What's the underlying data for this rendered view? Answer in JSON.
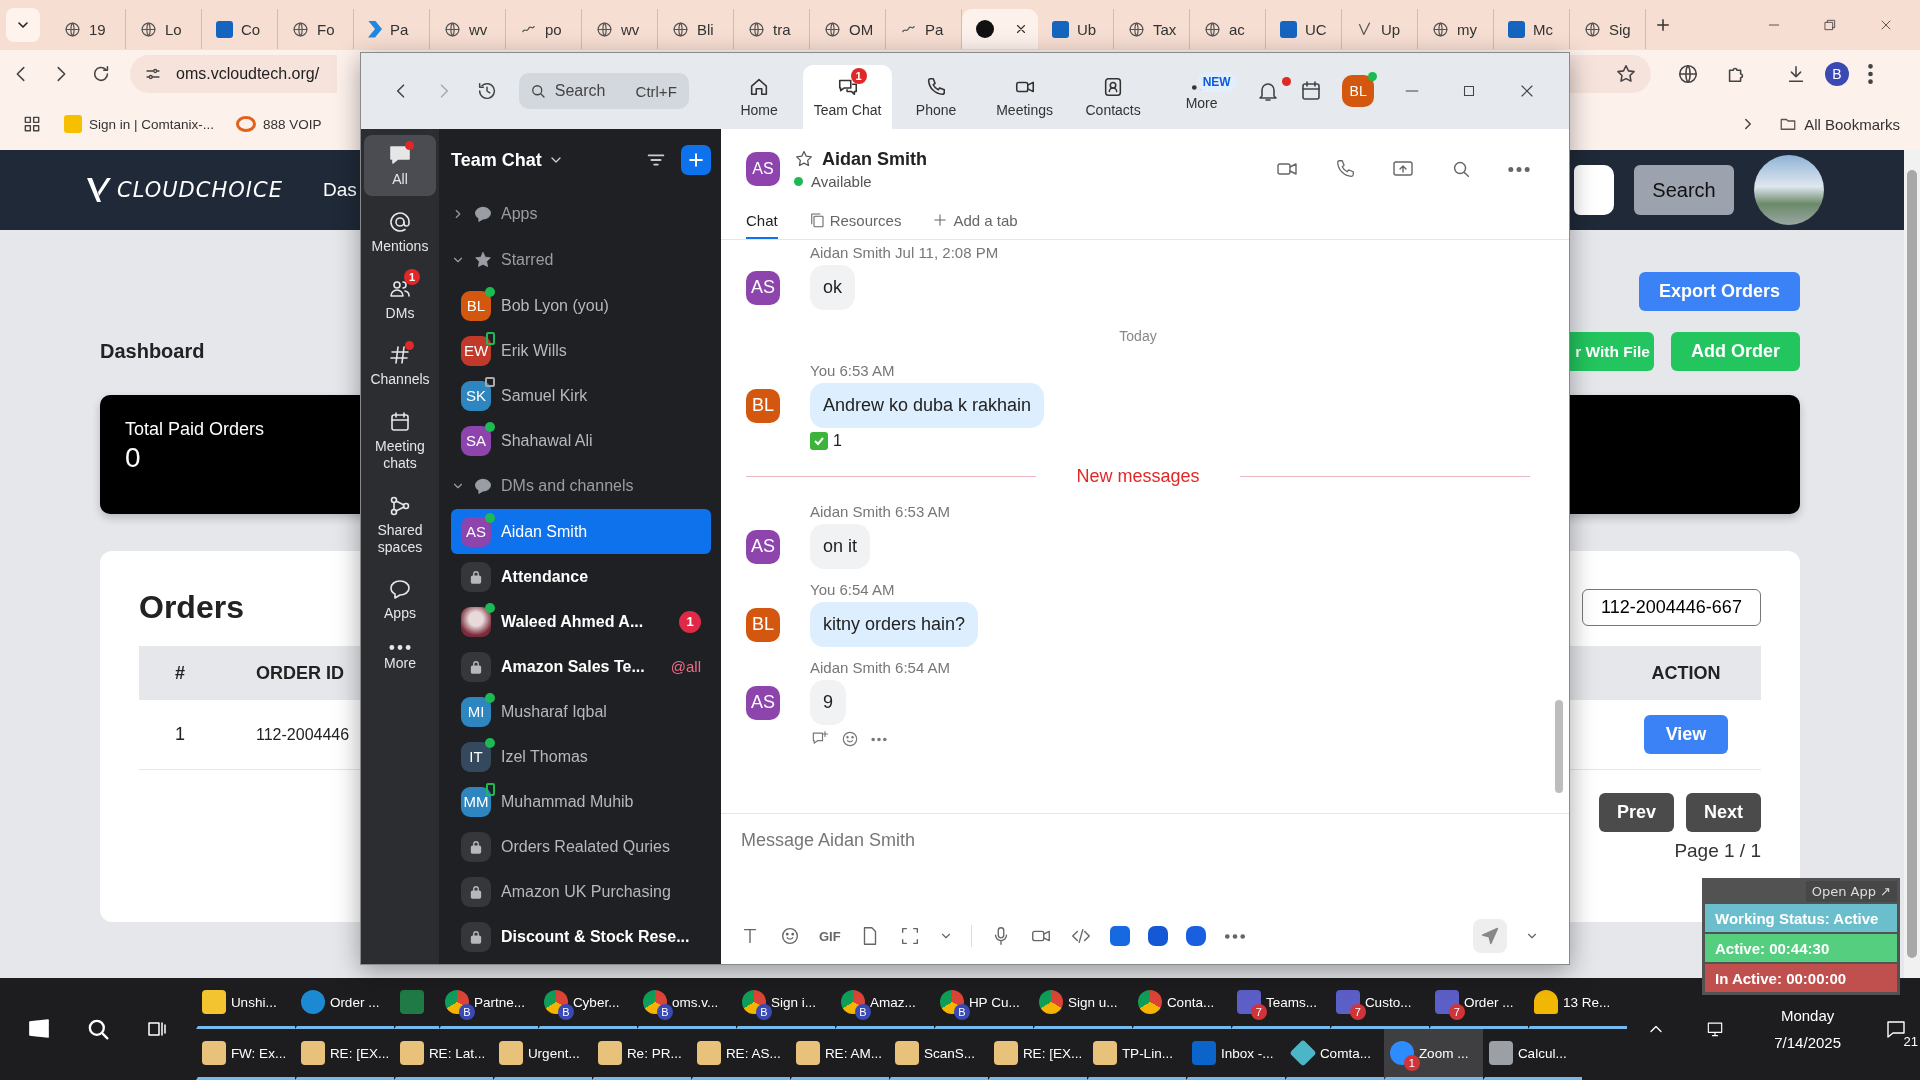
{
  "browser": {
    "tabs": [
      {
        "title": "19",
        "kind": "globe",
        "selected": false
      },
      {
        "title": "Lo",
        "kind": "globe",
        "selected": false
      },
      {
        "title": "Co",
        "kind": "box",
        "selected": false
      },
      {
        "title": "Fo",
        "kind": "globe",
        "selected": false
      },
      {
        "title": "Pa",
        "kind": "chevron",
        "selected": false
      },
      {
        "title": "wv",
        "kind": "globe",
        "selected": false
      },
      {
        "title": "po",
        "kind": "wave",
        "selected": false
      },
      {
        "title": "wv",
        "kind": "globe",
        "selected": false
      },
      {
        "title": "Bli",
        "kind": "globe",
        "selected": false
      },
      {
        "title": "tra",
        "kind": "globe",
        "selected": false
      },
      {
        "title": "OM",
        "kind": "globe",
        "selected": false
      },
      {
        "title": "Pa",
        "kind": "wave",
        "selected": false
      },
      {
        "kind": "dark",
        "selected": true
      },
      {
        "title": "Ub",
        "kind": "box",
        "selected": false
      },
      {
        "title": "Tax",
        "kind": "globe",
        "selected": false
      },
      {
        "title": "ac",
        "kind": "globe",
        "selected": false
      },
      {
        "title": "UC",
        "kind": "box",
        "selected": false
      },
      {
        "title": "Up",
        "kind": "check",
        "selected": false
      },
      {
        "title": "my",
        "kind": "globe",
        "selected": false
      },
      {
        "title": "Mc",
        "kind": "box",
        "selected": false
      },
      {
        "title": "Sig",
        "kind": "globe",
        "selected": false
      }
    ],
    "url": "oms.vcloudtech.org/",
    "profile": "B",
    "bookmarks": [
      {
        "label": "Sign in | Comtanix-...",
        "kind": "w"
      },
      {
        "label": "888 VOIP",
        "kind": "rings"
      }
    ],
    "all_bookmarks": "All Bookmarks"
  },
  "web_page": {
    "logo": "CLOUDCHOICE",
    "nav_item": "Das",
    "search_button": "Search",
    "heading": "Dashboard",
    "top_button": {
      "label": "Export Orders"
    },
    "buttons": [
      {
        "label": "r With File"
      },
      {
        "label": "Add Order"
      }
    ],
    "stat": {
      "label": "Total Paid Orders",
      "value": "0"
    },
    "orders": {
      "title": "Orders",
      "search_value": "112-2004446-667",
      "columns": [
        "#",
        "ORDER ID",
        "ACTION"
      ],
      "rows": [
        {
          "index": "1",
          "order_id": "112-2004446",
          "action": "View"
        }
      ],
      "prev": "Prev",
      "next": "Next",
      "page": "Page 1 / 1"
    }
  },
  "zoom": {
    "search": {
      "placeholder": "Search",
      "shortcut": "Ctrl+F"
    },
    "nav": [
      {
        "label": "Home",
        "kind": "home",
        "selected": false
      },
      {
        "label": "Team Chat",
        "kind": "chat",
        "selected": true,
        "badge": "1"
      },
      {
        "label": "Phone",
        "kind": "phone",
        "selected": false
      },
      {
        "label": "Meetings",
        "kind": "video",
        "selected": false
      },
      {
        "label": "Contacts",
        "kind": "contacts",
        "selected": false
      },
      {
        "label": "More",
        "kind": "more",
        "selected": false,
        "tag": "NEW"
      }
    ],
    "notification_dot": true,
    "user_initials": "BL",
    "rail": [
      {
        "label": "All",
        "kind": "chat",
        "selected": true,
        "dot": true
      },
      {
        "label": "Mentions",
        "kind": "at",
        "selected": false,
        "dot": false
      },
      {
        "label": "DMs",
        "kind": "people",
        "selected": false,
        "dot": false,
        "badge": "1"
      },
      {
        "label": "Channels",
        "kind": "hash",
        "selected": false,
        "dot": true
      },
      {
        "label": "Meeting chats",
        "kind": "calendar",
        "selected": false,
        "dot": false
      },
      {
        "label": "Shared spaces",
        "kind": "share",
        "selected": false,
        "dot": false
      },
      {
        "label": "Apps",
        "kind": "bubble",
        "selected": false,
        "dot": false
      },
      {
        "label": "More",
        "kind": "dots",
        "selected": false,
        "dot": false
      }
    ],
    "sidebar": {
      "title": "Team Chat",
      "sections": [
        {
          "label": "Apps",
          "kind": "bubble",
          "expanded": false
        },
        {
          "label": "Starred",
          "kind": "star",
          "expanded": true,
          "items": [
            {
              "name": "Bob Lyon (you)",
              "kind": "person",
              "initials": "BL",
              "color": "#d4570f",
              "online": true,
              "mobile": false,
              "in_meeting": false,
              "selected": false,
              "unread": false
            },
            {
              "name": "Erik Wills",
              "kind": "person",
              "initials": "EW",
              "color": "#c0392b",
              "online": false,
              "mobile": true,
              "in_meeting": false,
              "selected": false,
              "unread": false
            },
            {
              "name": "Samuel Kirk",
              "kind": "person",
              "initials": "SK",
              "color": "#2e86c1",
              "online": false,
              "mobile": false,
              "in_meeting": true,
              "selected": false,
              "unread": false
            },
            {
              "name": "Shahawal Ali",
              "kind": "person",
              "initials": "SA",
              "color": "#8e44ad",
              "online": true,
              "mobile": false,
              "in_meeting": false,
              "selected": false,
              "unread": false
            }
          ]
        },
        {
          "label": "DMs and channels",
          "kind": "bubble",
          "expanded": true,
          "items": [
            {
              "name": "Aidan Smith",
              "kind": "person",
              "initials": "AS",
              "color": "#8e44ad",
              "online": true,
              "mobile": false,
              "in_meeting": false,
              "selected": true,
              "unread": false
            },
            {
              "name": "Attendance",
              "kind": "channel",
              "online": false,
              "mobile": false,
              "in_meeting": false,
              "selected": false,
              "unread": true
            },
            {
              "name": "Waleed Ahmed A...",
              "kind": "photo",
              "online": true,
              "mobile": false,
              "in_meeting": false,
              "selected": false,
              "unread": true,
              "badge": "1"
            },
            {
              "name": "Amazon Sales Te...",
              "kind": "channel",
              "online": false,
              "mobile": false,
              "in_meeting": false,
              "selected": false,
              "unread": true,
              "mention": "@all"
            },
            {
              "name": "Musharaf Iqbal",
              "kind": "person",
              "initials": "MI",
              "color": "#2e86c1",
              "online": true,
              "mobile": false,
              "in_meeting": false,
              "selected": false,
              "unread": false
            },
            {
              "name": "Izel Thomas",
              "kind": "person",
              "initials": "IT",
              "color": "#34495e",
              "online": true,
              "mobile": false,
              "in_meeting": false,
              "selected": false,
              "unread": false
            },
            {
              "name": "Muhammad Muhib",
              "kind": "person",
              "initials": "MM",
              "color": "#2e86c1",
              "online": false,
              "mobile": true,
              "in_meeting": false,
              "selected": false,
              "unread": false
            },
            {
              "name": "Orders Realated Quries",
              "kind": "channel",
              "online": false,
              "mobile": false,
              "in_meeting": false,
              "selected": false,
              "unread": false
            },
            {
              "name": "Amazon UK Purchasing",
              "kind": "channel",
              "online": false,
              "mobile": false,
              "in_meeting": false,
              "selected": false,
              "unread": false
            },
            {
              "name": "Discount & Stock Rese...",
              "kind": "channel",
              "online": false,
              "mobile": false,
              "in_meeting": false,
              "selected": false,
              "unread": true
            }
          ]
        }
      ]
    },
    "chat": {
      "contact": {
        "name": "Aidan Smith",
        "initials": "AS",
        "color": "#8e44ad",
        "status": "Available",
        "starred": false
      },
      "tabs": [
        {
          "label": "Chat",
          "kind": "chat",
          "selected": true
        },
        {
          "label": "Resources",
          "kind": "resources",
          "selected": false
        },
        {
          "label": "Add a tab",
          "kind": "add",
          "selected": false
        }
      ],
      "messages": [
        {
          "kind": "message",
          "sender": "Aidan Smith",
          "time": "Jul 11, 2:08 PM",
          "initials": "AS",
          "color": "#8e44ad",
          "mine": false,
          "text": "ok"
        },
        {
          "kind": "date",
          "text": "Today"
        },
        {
          "kind": "message",
          "sender": "You",
          "time": "6:53 AM",
          "initials": "BL",
          "color": "#d4570f",
          "mine": true,
          "text": "Andrew ko duba k rakhain",
          "reaction": "1"
        },
        {
          "kind": "new",
          "text": "New messages"
        },
        {
          "kind": "message",
          "sender": "Aidan Smith",
          "time": "6:53 AM",
          "initials": "AS",
          "color": "#8e44ad",
          "mine": false,
          "text": "on it"
        },
        {
          "kind": "message",
          "sender": "You",
          "time": "6:54 AM",
          "initials": "BL",
          "color": "#d4570f",
          "mine": true,
          "text": "kitny orders hain?"
        },
        {
          "kind": "message",
          "sender": "Aidan Smith",
          "time": "6:54 AM",
          "initials": "AS",
          "color": "#8e44ad",
          "mine": false,
          "text": "9",
          "actions": true
        }
      ],
      "composer": {
        "placeholder": "Message Aidan Smith",
        "gif": "GIF"
      }
    }
  },
  "status_widget": {
    "open_app": "Open App ↗",
    "status": "Working Status: Active",
    "active": "Active: 00:44:30",
    "inactive": "In Active: 00:00:00"
  },
  "taskbar": {
    "upper_items": [
      {
        "label": "Unshi...",
        "kind": "notes",
        "selected": false
      },
      {
        "label": "Order ...",
        "kind": "edge",
        "selected": false
      },
      {
        "kind": "excel",
        "selected": false
      },
      {
        "label": "Partne...",
        "kind": "chrome",
        "selected": false,
        "badge": "B"
      },
      {
        "label": "Cyber...",
        "kind": "chrome",
        "selected": false,
        "badge": "B"
      },
      {
        "label": "oms.v...",
        "kind": "chrome",
        "selected": false,
        "badge": "B"
      },
      {
        "label": "Sign i...",
        "kind": "chrome",
        "selected": false,
        "badge": "B"
      },
      {
        "label": "Amaz...",
        "kind": "chrome",
        "selected": false,
        "badge": "B"
      },
      {
        "label": "HP Cu...",
        "kind": "chrome",
        "selected": false,
        "badge": "B"
      },
      {
        "label": "Sign u...",
        "kind": "chrome",
        "selected": false
      },
      {
        "label": "Conta...",
        "kind": "chrome",
        "selected": false
      },
      {
        "label": "Teams...",
        "kind": "teams",
        "selected": false,
        "badge": "7"
      },
      {
        "label": "Custo...",
        "kind": "teams",
        "selected": false,
        "badge": "7"
      },
      {
        "label": "Order ...",
        "kind": "teams",
        "selected": false,
        "badge": "7"
      },
      {
        "label": "13 Re...",
        "kind": "bell",
        "selected": false
      }
    ],
    "lower_items": [
      {
        "label": "FW: Ex...",
        "kind": "mail",
        "selected": false
      },
      {
        "label": "RE: [EX...",
        "kind": "mail",
        "selected": false
      },
      {
        "label": "RE: Lat...",
        "kind": "mail",
        "selected": false
      },
      {
        "label": "Urgent...",
        "kind": "mail",
        "selected": false
      },
      {
        "label": "Re: PR...",
        "kind": "mail",
        "selected": false
      },
      {
        "label": "RE: AS...",
        "kind": "mail",
        "selected": false
      },
      {
        "label": "RE: AM...",
        "kind": "mail",
        "selected": false
      },
      {
        "label": "ScanS...",
        "kind": "mail",
        "selected": false
      },
      {
        "label": "RE: [EX...",
        "kind": "mail",
        "selected": false
      },
      {
        "label": "TP-Lin...",
        "kind": "mail",
        "selected": false
      },
      {
        "label": "Inbox -...",
        "kind": "outlook",
        "selected": false
      },
      {
        "label": "Comta...",
        "kind": "comtanix",
        "selected": false
      },
      {
        "label": "Zoom ...",
        "kind": "zoom",
        "selected": true,
        "badge": "1"
      },
      {
        "label": "Calcul...",
        "kind": "calc",
        "selected": false
      }
    ],
    "day": "Monday",
    "date": "7/14/2025",
    "notifications": "21"
  }
}
